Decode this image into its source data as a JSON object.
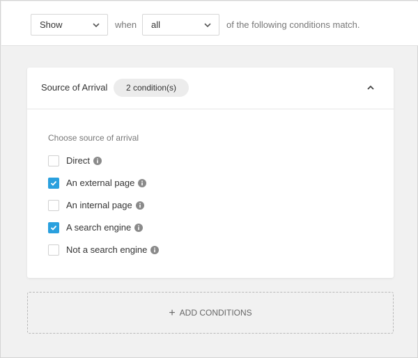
{
  "header": {
    "action_value": "Show",
    "when_text": "when",
    "match_value": "all",
    "suffix_text": "of the following conditions match."
  },
  "card": {
    "title": "Source of Arrival",
    "badge": "2 condition(s)",
    "section_label": "Choose source of arrival",
    "options": [
      {
        "label": "Direct",
        "checked": false
      },
      {
        "label": "An external page",
        "checked": true
      },
      {
        "label": "An internal page",
        "checked": false
      },
      {
        "label": "A search engine",
        "checked": true
      },
      {
        "label": "Not a search engine",
        "checked": false
      }
    ]
  },
  "add_button": {
    "label": "ADD CONDITIONS",
    "icon": "plus-icon"
  },
  "colors": {
    "accent": "#2aa0de",
    "panel_bg": "#f1f1f1",
    "info_icon": "#8a8a8a"
  }
}
